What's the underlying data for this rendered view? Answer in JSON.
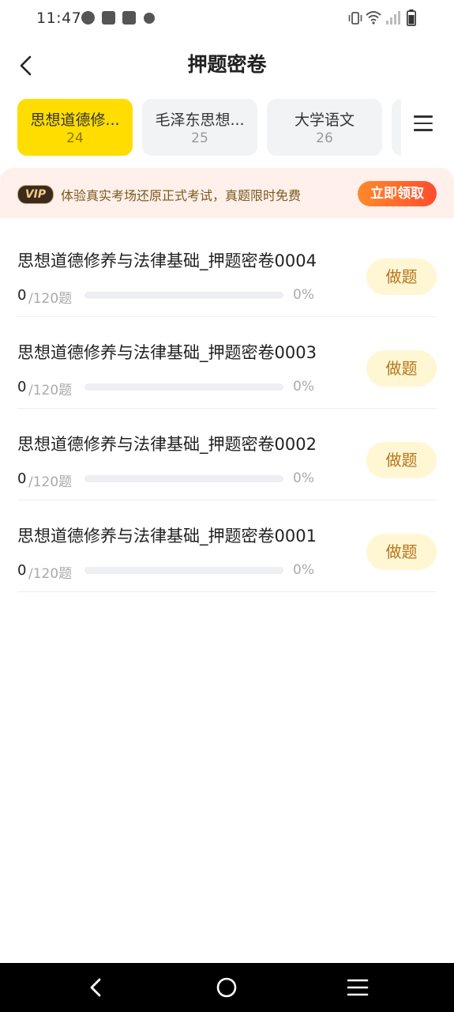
{
  "status_bar": {
    "time": "11:47"
  },
  "header": {
    "title": "押题密卷"
  },
  "tabs": [
    {
      "label": "思想道德修...",
      "count": "24",
      "active": true
    },
    {
      "label": "毛泽东思想...",
      "count": "25",
      "active": false
    },
    {
      "label": "大学语文",
      "count": "26",
      "active": false
    }
  ],
  "vip_banner": {
    "badge": "VIP",
    "text": "体验真实考场还原正式考试，真题限时免费",
    "cta": "立即领取"
  },
  "papers": [
    {
      "title": "思想道德修养与法律基础_押题密卷0004",
      "done": "0",
      "total": "/120题",
      "percent": "0%",
      "progress": 0,
      "action": "做题"
    },
    {
      "title": "思想道德修养与法律基础_押题密卷0003",
      "done": "0",
      "total": "/120题",
      "percent": "0%",
      "progress": 0,
      "action": "做题"
    },
    {
      "title": "思想道德修养与法律基础_押题密卷0002",
      "done": "0",
      "total": "/120题",
      "percent": "0%",
      "progress": 0,
      "action": "做题"
    },
    {
      "title": "思想道德修养与法律基础_押题密卷0001",
      "done": "0",
      "total": "/120题",
      "percent": "0%",
      "progress": 0,
      "action": "做题"
    }
  ],
  "icons": {
    "back": "back-arrow-icon",
    "menu": "hamburger-menu-icon",
    "nav_back": "nav-back-icon",
    "nav_home": "nav-home-icon",
    "nav_recent": "nav-recents-icon"
  },
  "colors": {
    "active_tab": "#ffdd00",
    "banner_bg": "#fff0ec",
    "cta_gradient_start": "#ff8a2a",
    "cta_gradient_end": "#ff4d2e",
    "action_button_bg": "#fff7d4",
    "action_button_text": "#b8731a"
  }
}
